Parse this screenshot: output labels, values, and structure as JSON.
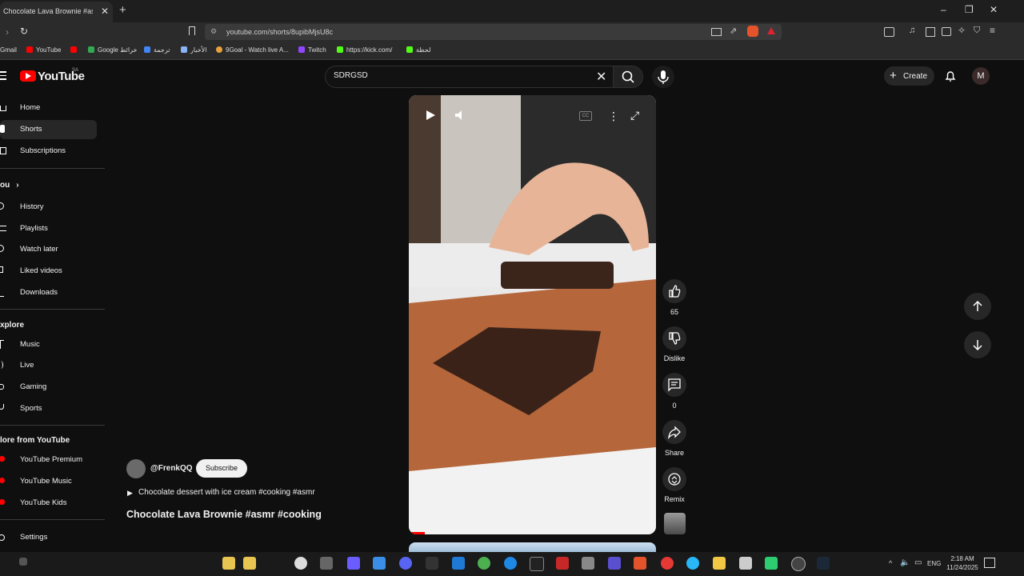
{
  "browser": {
    "tab_title": "Chocolate Lava Brownie #asmr #",
    "url": "youtube.com/shorts/8upibMjsU8c",
    "bookmarks": [
      "Gmail",
      "YouTube",
      "Google خرائط",
      "ترجمة",
      "الأخبار",
      "9Goal - Watch live A...",
      "Twitch",
      "https://kick.com/",
      "لحظة"
    ]
  },
  "youtube": {
    "logo_text": "YouTube",
    "logo_super": "SA",
    "search_value": "SDRGSD",
    "create_label": "Create",
    "avatar_letter": "M"
  },
  "sidebar": {
    "main": [
      "Home",
      "Shorts",
      "Subscriptions"
    ],
    "you_header": "ou",
    "you_items": [
      "History",
      "Playlists",
      "Watch later",
      "Liked videos",
      "Downloads"
    ],
    "explore_header": "xplore",
    "explore_items": [
      "Music",
      "Live",
      "Gaming",
      "Sports"
    ],
    "more_header": "lore from YouTube",
    "more_items": [
      "YouTube Premium",
      "YouTube Music",
      "YouTube Kids"
    ],
    "settings": "Settings"
  },
  "short": {
    "channel": "@FrenkQQ",
    "subscribe_label": "Subscribe",
    "description": "Chocolate dessert with ice cream #cooking #asmr",
    "title": "Chocolate Lava Brownie #asmr #cooking",
    "likes": "65",
    "dislike_label": "Dislike",
    "comments": "0",
    "share_label": "Share",
    "remix_label": "Remix",
    "progress": 0.06
  },
  "taskbar": {
    "lang": "ENG",
    "time": "2:18 AM",
    "date": "11/24/2025"
  }
}
